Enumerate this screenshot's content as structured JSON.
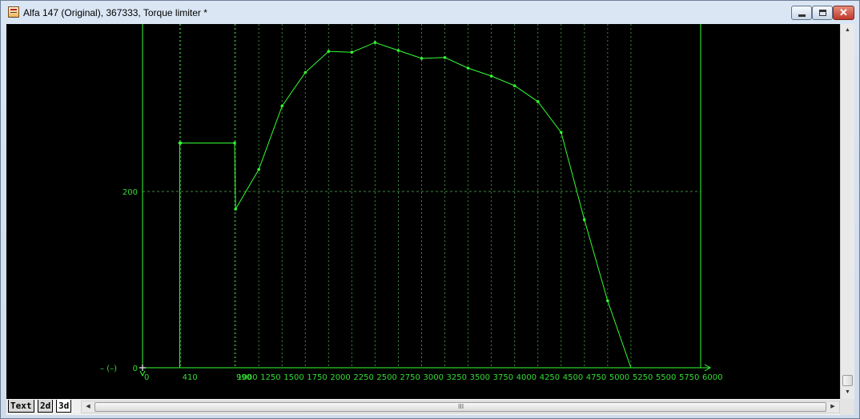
{
  "window": {
    "title": "Alfa 147 (Original), 367333, Torque limiter *",
    "icon": "map-sheet-icon",
    "min_icon": "minimize-icon",
    "max_icon": "maximize-icon",
    "close_icon": "close-icon",
    "close_glyph": "✕"
  },
  "colors": {
    "plot_background": "#000000",
    "curve": "#33ff33",
    "axis": "#33ff33",
    "grid": "#3a8a3a",
    "label": "#33dd33"
  },
  "chart_data": {
    "type": "line",
    "xlabel": "",
    "ylabel": "",
    "y_axis_unit_label": "– (–)",
    "xlim": [
      0,
      6000
    ],
    "ylim": [
      0,
      370
    ],
    "grid": true,
    "x_tick_labels": [
      {
        "value": 0,
        "label": "0"
      },
      {
        "value": 410,
        "label": "410"
      },
      {
        "value": 990,
        "label": "990"
      },
      {
        "value": 1000,
        "label": "1000"
      },
      {
        "value": 1250,
        "label": "1250"
      },
      {
        "value": 1500,
        "label": "1500"
      },
      {
        "value": 1750,
        "label": "1750"
      },
      {
        "value": 2000,
        "label": "2000"
      },
      {
        "value": 2250,
        "label": "2250"
      },
      {
        "value": 2500,
        "label": "2500"
      },
      {
        "value": 2750,
        "label": "2750"
      },
      {
        "value": 3000,
        "label": "3000"
      },
      {
        "value": 3250,
        "label": "3250"
      },
      {
        "value": 3500,
        "label": "3500"
      },
      {
        "value": 3750,
        "label": "3750"
      },
      {
        "value": 4000,
        "label": "4000"
      },
      {
        "value": 4250,
        "label": "4250"
      },
      {
        "value": 4500,
        "label": "4500"
      },
      {
        "value": 4750,
        "label": "4750"
      },
      {
        "value": 5000,
        "label": "5000"
      },
      {
        "value": 5250,
        "label": "5250"
      },
      {
        "value": 5500,
        "label": "5500"
      },
      {
        "value": 5750,
        "label": "5750"
      },
      {
        "value": 6000,
        "label": "6000"
      }
    ],
    "y_tick_labels": [
      {
        "value": 0,
        "label": "0"
      },
      {
        "value": 200,
        "label": "200"
      }
    ],
    "series": [
      {
        "points": [
          [
            400,
            0
          ],
          [
            400,
            255
          ],
          [
            410,
            255
          ],
          [
            990,
            255
          ],
          [
            1000,
            180
          ],
          [
            1250,
            225
          ],
          [
            1500,
            297
          ],
          [
            1750,
            335
          ],
          [
            2000,
            359
          ],
          [
            2250,
            358
          ],
          [
            2500,
            369
          ],
          [
            2750,
            360
          ],
          [
            3000,
            351
          ],
          [
            3250,
            352
          ],
          [
            3500,
            340
          ],
          [
            3750,
            331
          ],
          [
            4000,
            320
          ],
          [
            4250,
            302
          ],
          [
            4500,
            267
          ],
          [
            4750,
            168
          ],
          [
            5000,
            76
          ],
          [
            5250,
            0
          ]
        ]
      }
    ]
  },
  "tabs": [
    {
      "label": "Text"
    },
    {
      "label": "2d"
    },
    {
      "label": "3d"
    }
  ],
  "scrollbar": {
    "up_icon": "▲",
    "down_icon": "▼",
    "left_icon": "◀",
    "right_icon": "▶",
    "grip": "III"
  }
}
